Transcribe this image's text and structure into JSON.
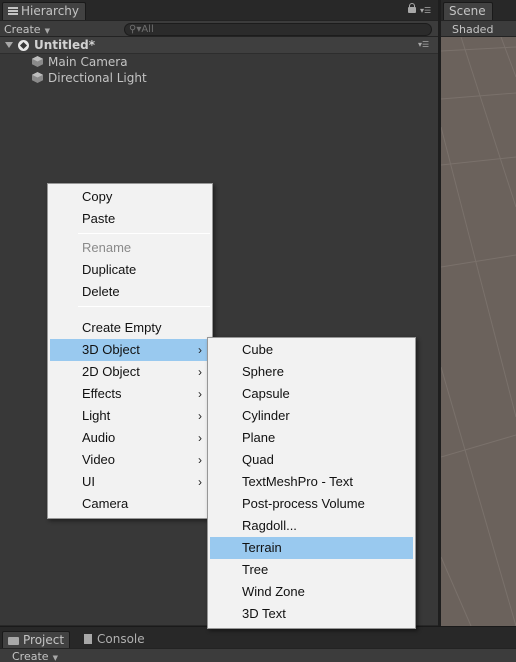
{
  "hierarchy": {
    "tab_label": "Hierarchy",
    "create_label": "Create",
    "search_placeholder": "All",
    "scene_name": "Untitled*",
    "objects": [
      "Main Camera",
      "Directional Light"
    ]
  },
  "scene": {
    "tab_label": "Scene",
    "shading_mode": "Shaded"
  },
  "bottom": {
    "project_tab": "Project",
    "console_tab": "Console",
    "create_label": "Create"
  },
  "context_menu": {
    "copy": "Copy",
    "paste": "Paste",
    "rename": "Rename",
    "duplicate": "Duplicate",
    "delete": "Delete",
    "create_empty": "Create Empty",
    "object_3d": "3D Object",
    "object_2d": "2D Object",
    "effects": "Effects",
    "light": "Light",
    "audio": "Audio",
    "video": "Video",
    "ui": "UI",
    "camera": "Camera",
    "submenu_arrow": "›"
  },
  "submenu_3d": {
    "items": [
      "Cube",
      "Sphere",
      "Capsule",
      "Cylinder",
      "Plane",
      "Quad",
      "TextMeshPro - Text",
      "Post-process Volume",
      "Ragdoll...",
      "Terrain",
      "Tree",
      "Wind Zone",
      "3D Text"
    ],
    "highlighted": "Terrain"
  },
  "colors": {
    "menu_highlight": "#99c9ef",
    "menu_background": "#f2f2f2",
    "panel_background": "#383838",
    "scene_background": "#6b625c"
  }
}
